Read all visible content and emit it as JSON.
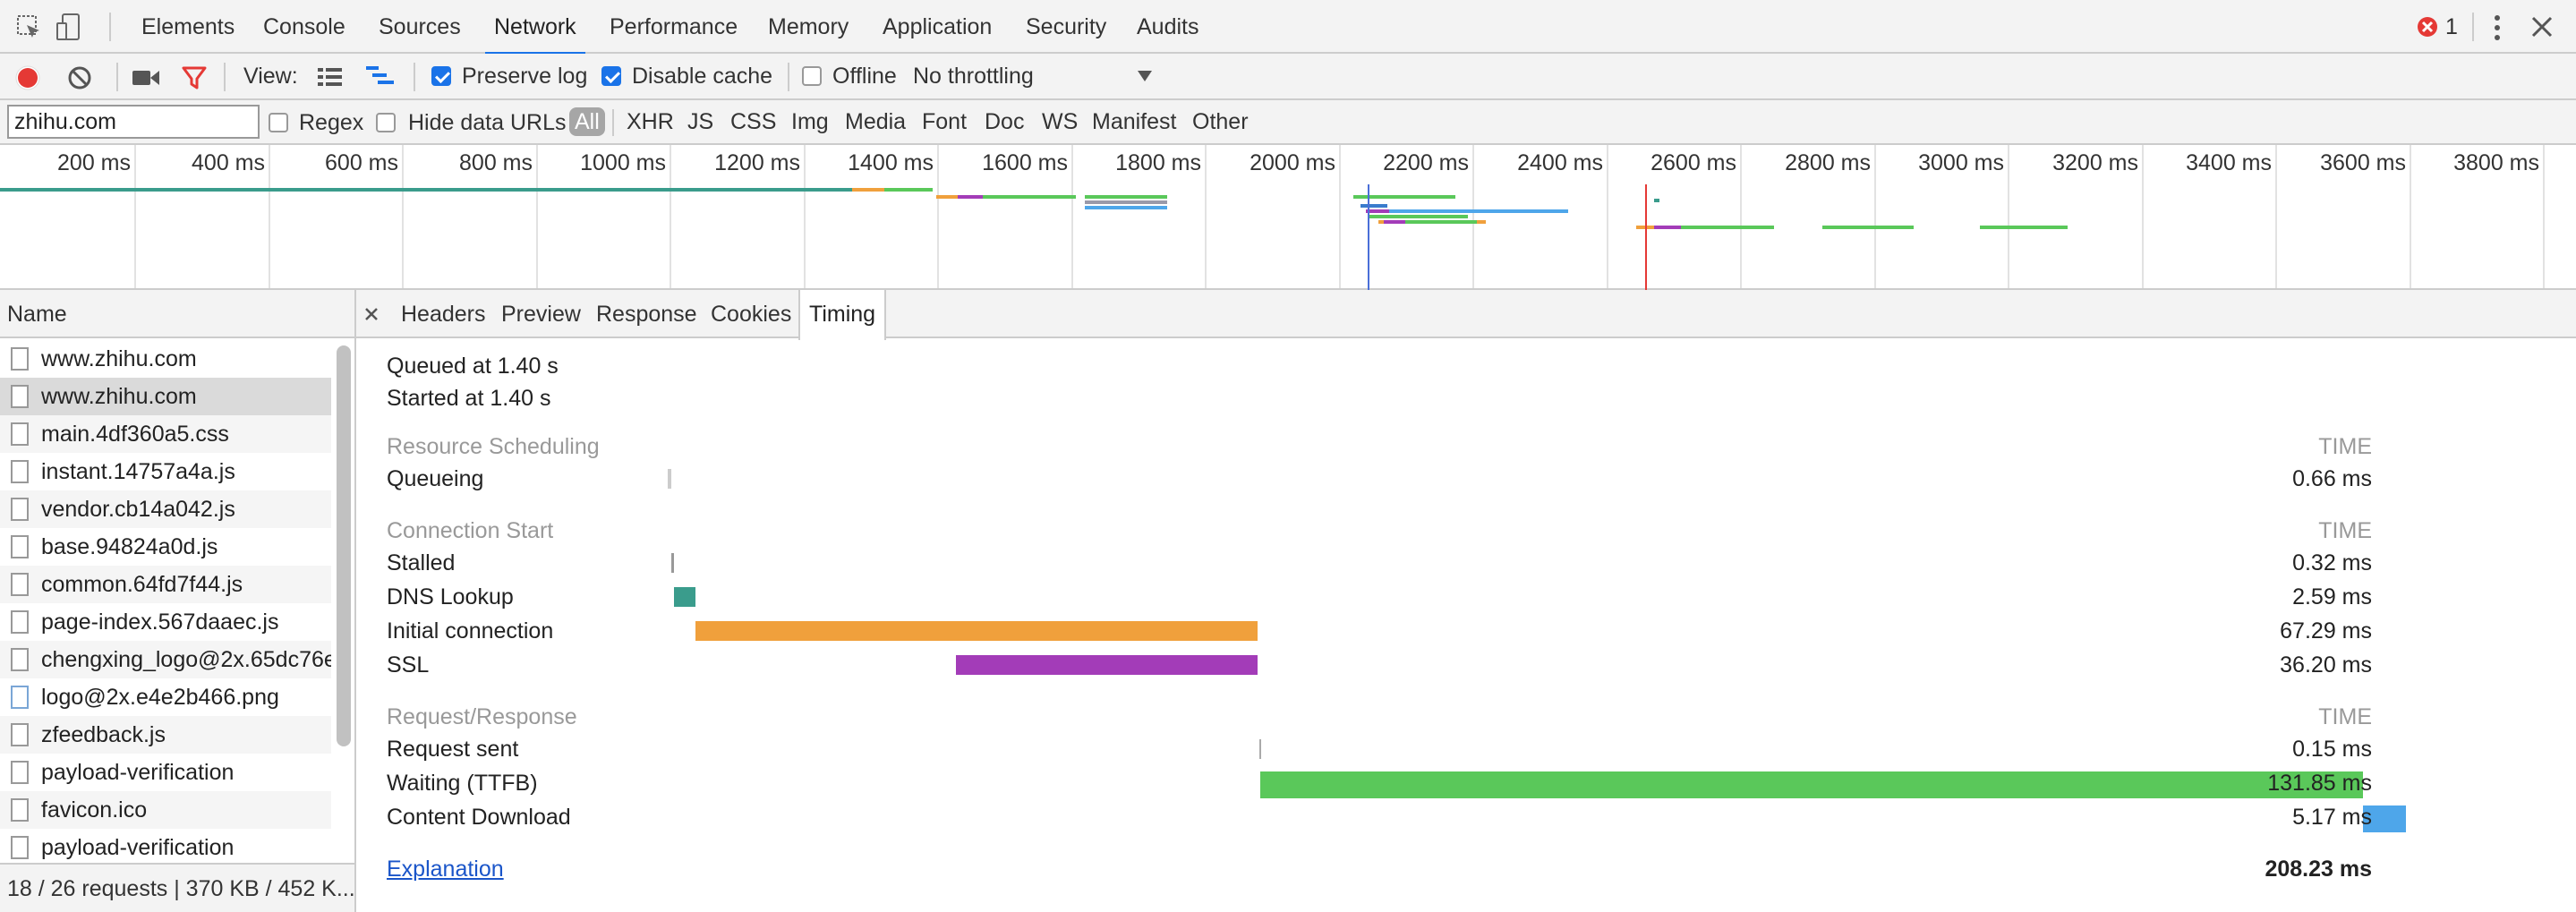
{
  "tabs": [
    "Elements",
    "Console",
    "Sources",
    "Network",
    "Performance",
    "Memory",
    "Application",
    "Security",
    "Audits"
  ],
  "active_tab": "Network",
  "error_count": "1",
  "toolbar": {
    "view_label": "View:",
    "preserve_log": "Preserve log",
    "disable_cache": "Disable cache",
    "offline": "Offline",
    "throttling": "No throttling"
  },
  "filter": {
    "value": "zhihu.com",
    "regex": "Regex",
    "hide_data_urls": "Hide data URLs",
    "types": [
      "All",
      "XHR",
      "JS",
      "CSS",
      "Img",
      "Media",
      "Font",
      "Doc",
      "WS",
      "Manifest",
      "Other"
    ]
  },
  "overview": {
    "ticks": [
      "200 ms",
      "400 ms",
      "600 ms",
      "800 ms",
      "1000 ms",
      "1200 ms",
      "1400 ms",
      "1600 ms",
      "1800 ms",
      "2000 ms",
      "2200 ms",
      "2400 ms",
      "2600 ms",
      "2800 ms",
      "3000 ms",
      "3200 ms",
      "3400 ms",
      "3600 ms",
      "3800 ms"
    ]
  },
  "requests": {
    "header": "Name",
    "items": [
      "www.zhihu.com",
      "www.zhihu.com",
      "main.4df360a5.css",
      "instant.14757a4a.js",
      "vendor.cb14a042.js",
      "base.94824a0d.js",
      "common.64fd7f44.js",
      "page-index.567daaec.js",
      "chengxing_logo@2x.65dc76e.",
      "logo@2x.e4e2b466.png",
      "zfeedback.js",
      "payload-verification",
      "favicon.ico",
      "payload-verification"
    ],
    "selected_index": 1,
    "status": "18 / 26 requests | 370 KB / 452 K..."
  },
  "detail_tabs": [
    "Headers",
    "Preview",
    "Response",
    "Cookies",
    "Timing"
  ],
  "detail_active": "Timing",
  "timing": {
    "queued": "Queued at 1.40 s",
    "started": "Started at 1.40 s",
    "time_header": "TIME",
    "sections": [
      {
        "title": "Resource Scheduling",
        "rows": [
          {
            "label": "Queueing",
            "value": "0.66 ms"
          }
        ]
      },
      {
        "title": "Connection Start",
        "rows": [
          {
            "label": "Stalled",
            "value": "0.32 ms"
          },
          {
            "label": "DNS Lookup",
            "value": "2.59 ms"
          },
          {
            "label": "Initial connection",
            "value": "67.29 ms"
          },
          {
            "label": "SSL",
            "value": "36.20 ms"
          }
        ]
      },
      {
        "title": "Request/Response",
        "rows": [
          {
            "label": "Request sent",
            "value": "0.15 ms"
          },
          {
            "label": "Waiting (TTFB)",
            "value": "131.85 ms"
          },
          {
            "label": "Content Download",
            "value": "5.17 ms"
          }
        ]
      }
    ],
    "explanation": "Explanation",
    "total": "208.23 ms"
  },
  "colors": {
    "queueing": "#cccccc",
    "stalled": "#999999",
    "dns": "#3a9c8c",
    "connection": "#f0a03c",
    "ssl": "#a33cb8",
    "request": "#aaaaaa",
    "waiting": "#5ac85a",
    "download": "#4ea6ea"
  }
}
